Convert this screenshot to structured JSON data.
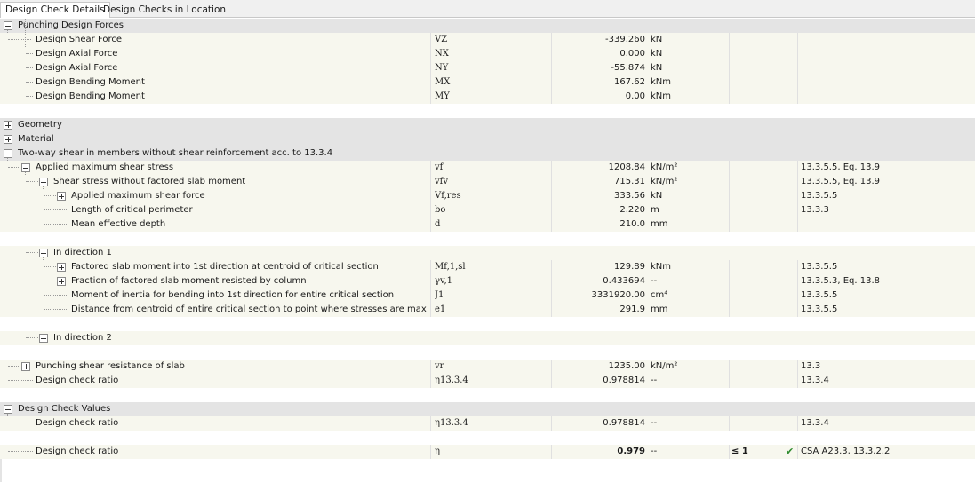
{
  "tabs": [
    {
      "label": "Design Check Details",
      "active": true
    },
    {
      "label": "Design Checks in Location",
      "active": false
    }
  ],
  "sections": {
    "punching": {
      "title": "Punching Design Forces",
      "rows": [
        {
          "label": "Design Shear Force",
          "sym": "VZ",
          "value": "-339.260",
          "unit": "kN"
        },
        {
          "label": "Design Axial Force",
          "sym": "NX",
          "value": "0.000",
          "unit": "kN"
        },
        {
          "label": "Design Axial Force",
          "sym": "NY",
          "value": "-55.874",
          "unit": "kN"
        },
        {
          "label": "Design Bending Moment",
          "sym": "MX",
          "value": "167.62",
          "unit": "kNm"
        },
        {
          "label": "Design Bending Moment",
          "sym": "MY",
          "value": "0.00",
          "unit": "kNm"
        }
      ]
    },
    "geometry": {
      "title": "Geometry"
    },
    "material": {
      "title": "Material"
    },
    "twoway": {
      "title": "Two-way shear in members without shear reinforcement acc. to 13.3.4",
      "applied": {
        "label": "Applied maximum shear stress",
        "sym": "vf",
        "value": "1208.84",
        "unit": "kN/m²",
        "ref": "13.3.5.5, Eq. 13.9"
      },
      "shear_wo": {
        "label": "Shear stress without factored slab moment",
        "sym": "vfv",
        "value": "715.31",
        "unit": "kN/m²",
        "ref": "13.3.5.5, Eq. 13.9"
      },
      "applied_force": {
        "label": "Applied maximum shear force",
        "sym": "Vf,res",
        "value": "333.56",
        "unit": "kN",
        "ref": "13.3.5.5"
      },
      "perimeter": {
        "label": "Length of critical perimeter",
        "sym": "bo",
        "value": "2.220",
        "unit": "m",
        "ref": "13.3.3"
      },
      "depth": {
        "label": "Mean effective depth",
        "sym": "d",
        "value": "210.0",
        "unit": "mm",
        "ref": ""
      },
      "dir1": {
        "label": "In direction 1",
        "moment": {
          "label": "Factored slab moment into 1st direction at centroid of critical section",
          "sym": "Mf,1,sl",
          "value": "129.89",
          "unit": "kNm",
          "ref": "13.3.5.5"
        },
        "fraction": {
          "label": "Fraction of factored slab moment resisted by column",
          "sym": "γv,1",
          "value": "0.433694",
          "unit": "--",
          "ref": "13.3.5.3, Eq. 13.8"
        },
        "inertia": {
          "label": "Moment of inertia for bending into 1st direction for entire critical section",
          "sym": "J1",
          "value": "3331920.00",
          "unit": "cm⁴",
          "ref": "13.3.5.5"
        },
        "distance": {
          "label": "Distance from centroid of entire critical section to point where stresses are maximum",
          "sym": "e1",
          "value": "291.9",
          "unit": "mm",
          "ref": "13.3.5.5"
        }
      },
      "dir2": {
        "label": "In direction 2"
      },
      "resistance": {
        "label": "Punching shear resistance of slab",
        "sym": "vr",
        "value": "1235.00",
        "unit": "kN/m²",
        "ref": "13.3"
      },
      "ratio": {
        "label": "Design check ratio",
        "sym": "η13.3.4",
        "value": "0.978814",
        "unit": "--",
        "ref": "13.3.4"
      }
    },
    "values": {
      "title": "Design Check Values",
      "ratio1": {
        "label": "Design check ratio",
        "sym": "η13.3.4",
        "value": "0.978814",
        "unit": "--",
        "ref": "13.3.4"
      },
      "ratio2": {
        "label": "Design check ratio",
        "sym": "η",
        "value": "0.979",
        "unit": "--",
        "condition": "≤ 1",
        "status_icon": "check-icon",
        "ref": "CSA A23.3, 13.3.2.2"
      }
    }
  },
  "colors": {
    "section_bg": "#e4e4e4",
    "row_bg": "#f7f7ee",
    "check": "#2e8b2e"
  }
}
